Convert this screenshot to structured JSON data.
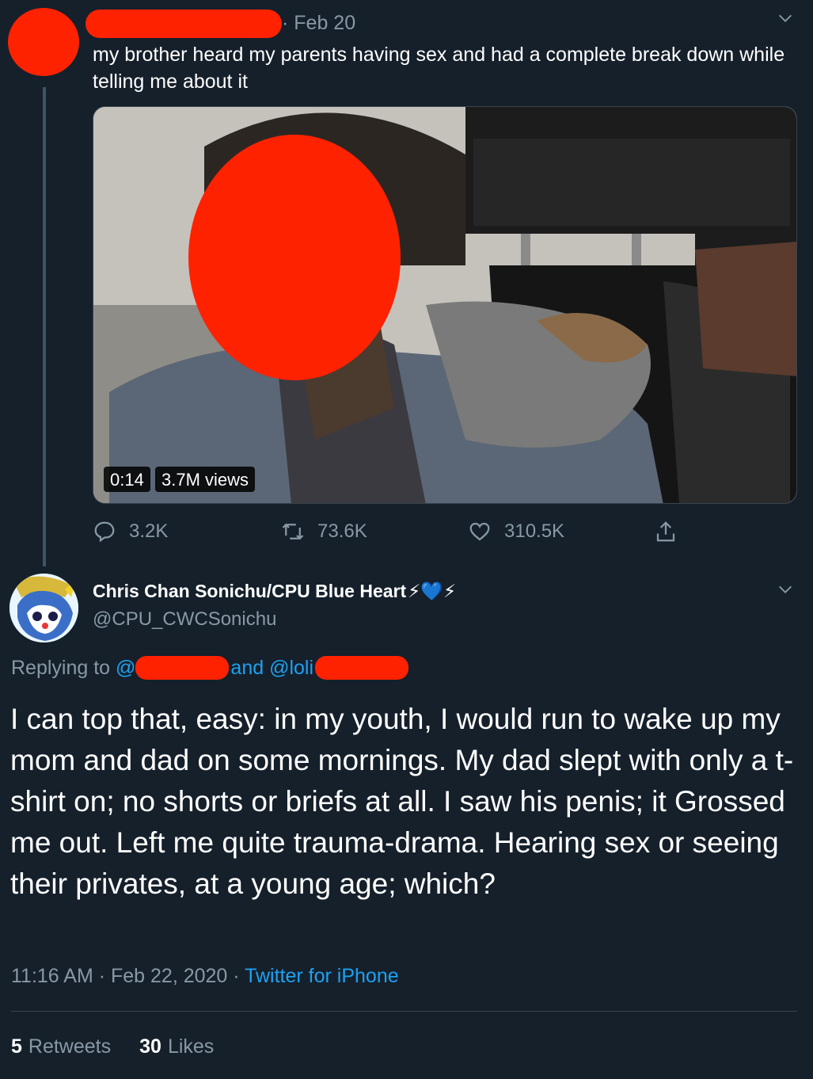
{
  "top_tweet": {
    "date": "· Feb 20",
    "text": "my brother heard my parents having sex and had a complete break down while telling me about it",
    "video": {
      "duration": "0:14",
      "views": "3.7M views"
    },
    "actions": {
      "replies": "3.2K",
      "retweets": "73.6K",
      "likes": "310.5K"
    }
  },
  "reply_tweet": {
    "name": "Chris Chan Sonichu/CPU Blue Heart",
    "name_emoji": "⚡💙⚡",
    "handle": "@CPU_CWCSonichu",
    "replying_prefix": "Replying to",
    "replying_at1": "@",
    "replying_and": "and @loli",
    "text": "I can top that, easy: in my youth, I would run to wake up my mom and dad on some mornings. My dad slept with only a t-shirt on; no shorts or briefs at all. I saw his penis; it Grossed me out. Left me quite trauma-drama. Hearing sex or seeing their privates, at a young age; which?",
    "time": "11:16 AM · Feb 22, 2020 · ",
    "client": "Twitter for iPhone",
    "retweets_count": "5",
    "retweets_label": "Retweets",
    "likes_count": "30",
    "likes_label": "Likes"
  },
  "colors": {
    "background": "#15202b",
    "muted": "#8899a6",
    "link": "#1da1f2",
    "redaction": "#ff2200"
  }
}
